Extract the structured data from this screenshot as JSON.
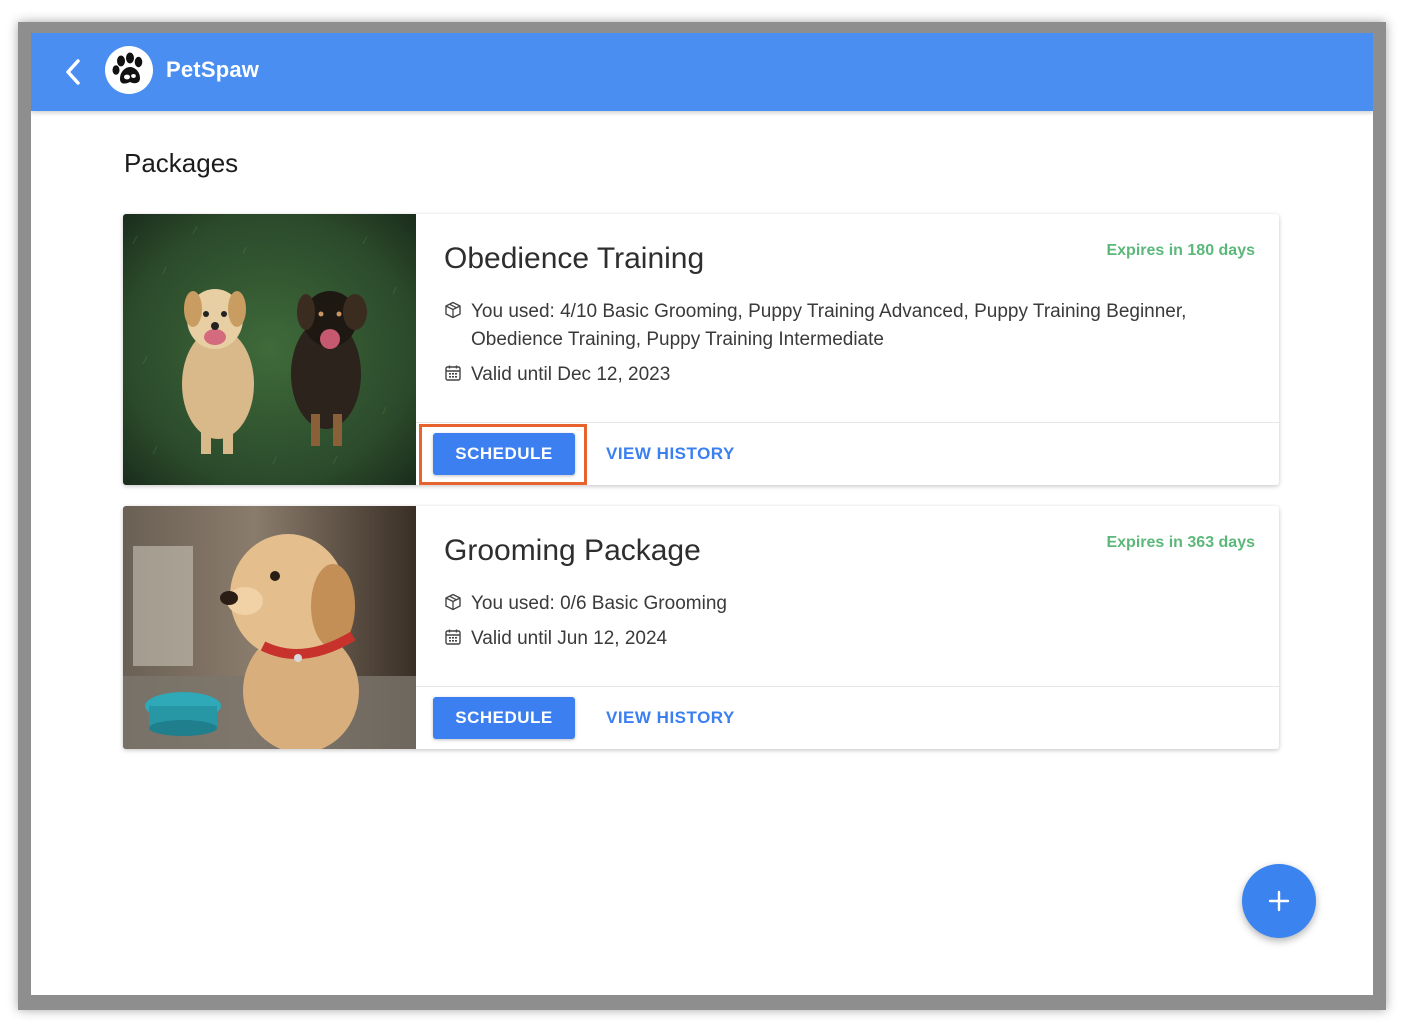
{
  "header": {
    "back_icon": "chevron-left-icon",
    "logo_icon": "paw-icon",
    "app_name": "PetSpaw",
    "color": "#4a8ef2"
  },
  "page": {
    "title": "Packages"
  },
  "packages": [
    {
      "title": "Obedience Training",
      "expires": "Expires in 180 days",
      "used": "You used: 4/10 Basic Grooming, Puppy Training Advanced, Puppy Training Beginner, Obedience Training, Puppy Training Intermediate",
      "valid": "Valid until Dec 12, 2023",
      "image": "two-dogs-on-grass-photo",
      "schedule_label": "SCHEDULE",
      "history_label": "VIEW HISTORY"
    },
    {
      "title": "Grooming Package",
      "expires": "Expires in 363 days",
      "used": "You used: 0/6 Basic Grooming",
      "valid": "Valid until Jun 12, 2024",
      "image": "puppy-with-red-collar-photo",
      "schedule_label": "SCHEDULE",
      "history_label": "VIEW HISTORY"
    }
  ],
  "fab": {
    "icon": "plus-icon"
  },
  "colors": {
    "accent": "#3b7ff0",
    "expires": "#5cb87a",
    "highlight": "#e8622e"
  }
}
